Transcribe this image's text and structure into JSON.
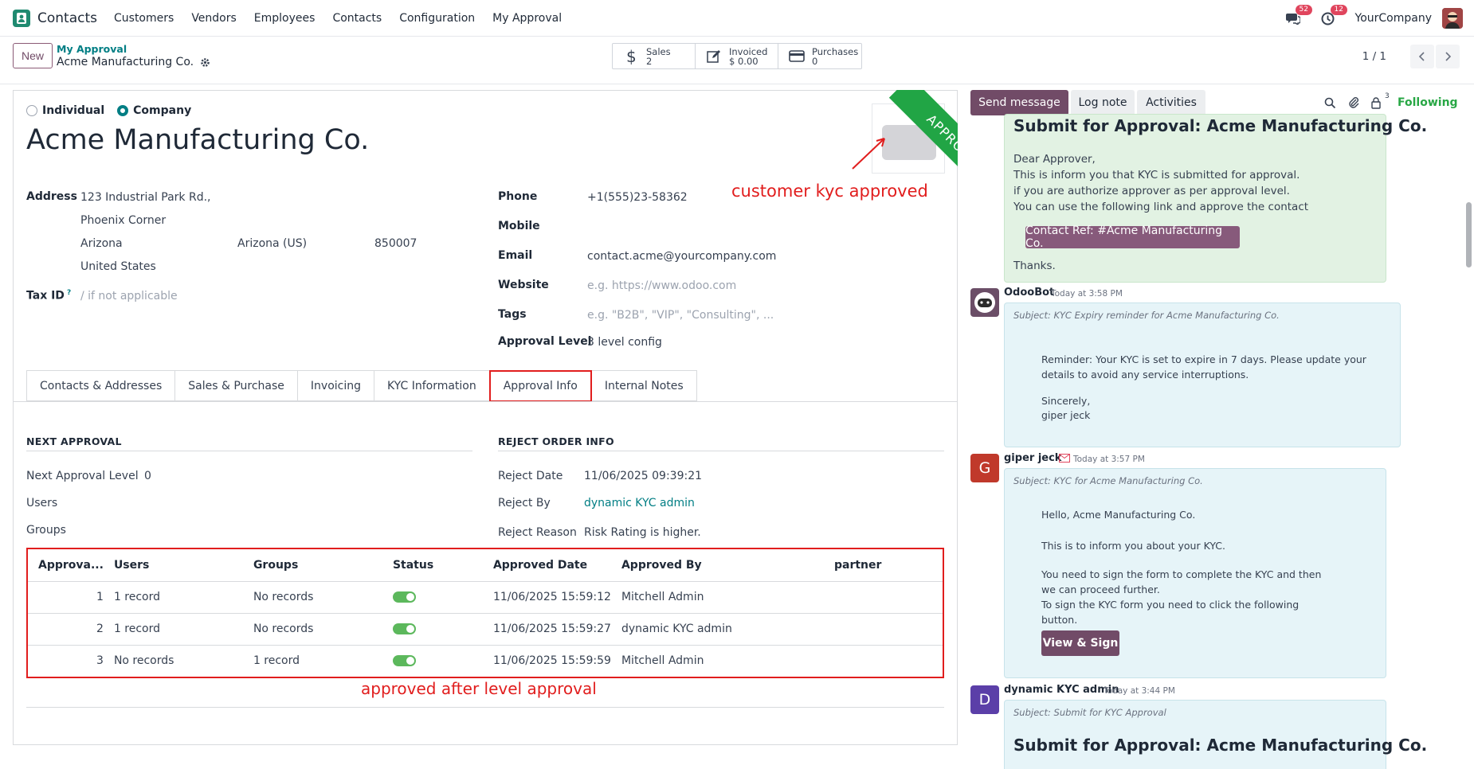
{
  "topbar": {
    "app_name": "Contacts",
    "menu": [
      "Customers",
      "Vendors",
      "Employees",
      "Contacts",
      "Configuration",
      "My Approval"
    ],
    "messages_count": "52",
    "activities_count": "12",
    "company": "YourCompany"
  },
  "control_panel": {
    "new_label": "New",
    "breadcrumb_parent": "My Approval",
    "breadcrumb_current": "Acme Manufacturing Co.",
    "stats": [
      {
        "label": "Sales",
        "value": "2"
      },
      {
        "label": "Invoiced",
        "value": "$ 0.00"
      },
      {
        "label": "Purchases",
        "value": "0"
      }
    ],
    "pager": "1 / 1"
  },
  "form": {
    "ribbon": "APPROVED",
    "type_individual": "Individual",
    "type_company": "Company",
    "name": "Acme Manufacturing Co.",
    "address_label": "Address",
    "street": "123 Industrial Park Rd.,",
    "street2": "Phoenix Corner",
    "city": "Arizona",
    "state": "Arizona (US)",
    "zip": "850007",
    "country": "United States",
    "taxid_label": "Tax ID",
    "taxid_sup": "?",
    "taxid_placeholder": "/ if not applicable",
    "phone_label": "Phone",
    "phone": "+1(555)23-58362",
    "mobile_label": "Mobile",
    "email_label": "Email",
    "email": "contact.acme@yourcompany.com",
    "website_label": "Website",
    "website_placeholder": "e.g. https://www.odoo.com",
    "tags_label": "Tags",
    "tags_placeholder": "e.g. \"B2B\", \"VIP\", \"Consulting\", ...",
    "approval_level_label": "Approval Level",
    "approval_level": "3 level config",
    "annotation_kyc": "customer kyc approved",
    "tabs": [
      "Contacts & Addresses",
      "Sales & Purchase",
      "Invoicing",
      "KYC Information",
      "Approval Info",
      "Internal Notes"
    ],
    "next_approval_header": "NEXT APPROVAL",
    "next_level_label": "Next Approval Level",
    "next_level": "0",
    "users_label": "Users",
    "groups_label": "Groups",
    "reject_header": "REJECT ORDER INFO",
    "reject_date_label": "Reject Date",
    "reject_date": "11/06/2025 09:39:21",
    "reject_by_label": "Reject By",
    "reject_by": "dynamic KYC admin",
    "reject_reason_label": "Reject Reason",
    "reject_reason": "Risk Rating is higher.",
    "table_headers": [
      "Approva...",
      "Users",
      "Groups",
      "Status",
      "Approved Date",
      "Approved By",
      "partner"
    ],
    "rows": [
      {
        "level": "1",
        "users": "1 record",
        "groups": "No records",
        "status": true,
        "date": "11/06/2025 15:59:12",
        "by": "Mitchell Admin",
        "partner": ""
      },
      {
        "level": "2",
        "users": "1 record",
        "groups": "No records",
        "status": true,
        "date": "11/06/2025 15:59:27",
        "by": "dynamic KYC admin",
        "partner": ""
      },
      {
        "level": "3",
        "users": "No records",
        "groups": "1 record",
        "status": true,
        "date": "11/06/2025 15:59:59",
        "by": "Mitchell Admin",
        "partner": ""
      }
    ],
    "annotation_table": "approved after level approval"
  },
  "chatter": {
    "send_message": "Send message",
    "log_note": "Log note",
    "activities": "Activities",
    "followers_count": "3",
    "following": "Following",
    "msg1": {
      "title": "Submit for Approval: Acme Manufacturing Co.",
      "lines": [
        "Dear Approver,",
        "This is inform you that KYC is submitted for approval.",
        "if you are authorize approver as per approval level.",
        "You can use the following link and approve the contact"
      ],
      "link_label": "Contact Ref: #Acme Manufacturing Co.",
      "thanks": "Thanks."
    },
    "msg2": {
      "author": "OdooBot",
      "time": "Today at 3:58 PM",
      "subject": "Subject: KYC Expiry reminder for Acme Manufacturing Co.",
      "line1": "Reminder: Your KYC is set to expire in 7 days. Please update your",
      "line2": "details to avoid any service interruptions.",
      "line3": "Sincerely,",
      "line4": "giper jeck"
    },
    "msg3": {
      "author": "giper jeck",
      "avatar": "G",
      "time": "Today at 3:57 PM",
      "subject": "Subject: KYC for Acme Manufacturing Co.",
      "line1": "Hello, Acme Manufacturing Co.",
      "line2": "This is to inform you about your KYC.",
      "line3": "You need to sign the form to complete the KYC and then",
      "line4": "we can proceed further.",
      "line5": "To sign the KYC form you need to click the following",
      "line6": "button.",
      "button": "View & Sign"
    },
    "msg4": {
      "author": "dynamic KYC admin",
      "avatar": "D",
      "time": "Today at 3:44 PM",
      "subject": "Subject: Submit for KYC Approval",
      "title": "Submit for Approval: Acme Manufacturing Co."
    }
  },
  "colors": {
    "brand": "#714b67",
    "accent": "#017e84",
    "approved": "#28a745",
    "annotation": "#e11d1d"
  }
}
